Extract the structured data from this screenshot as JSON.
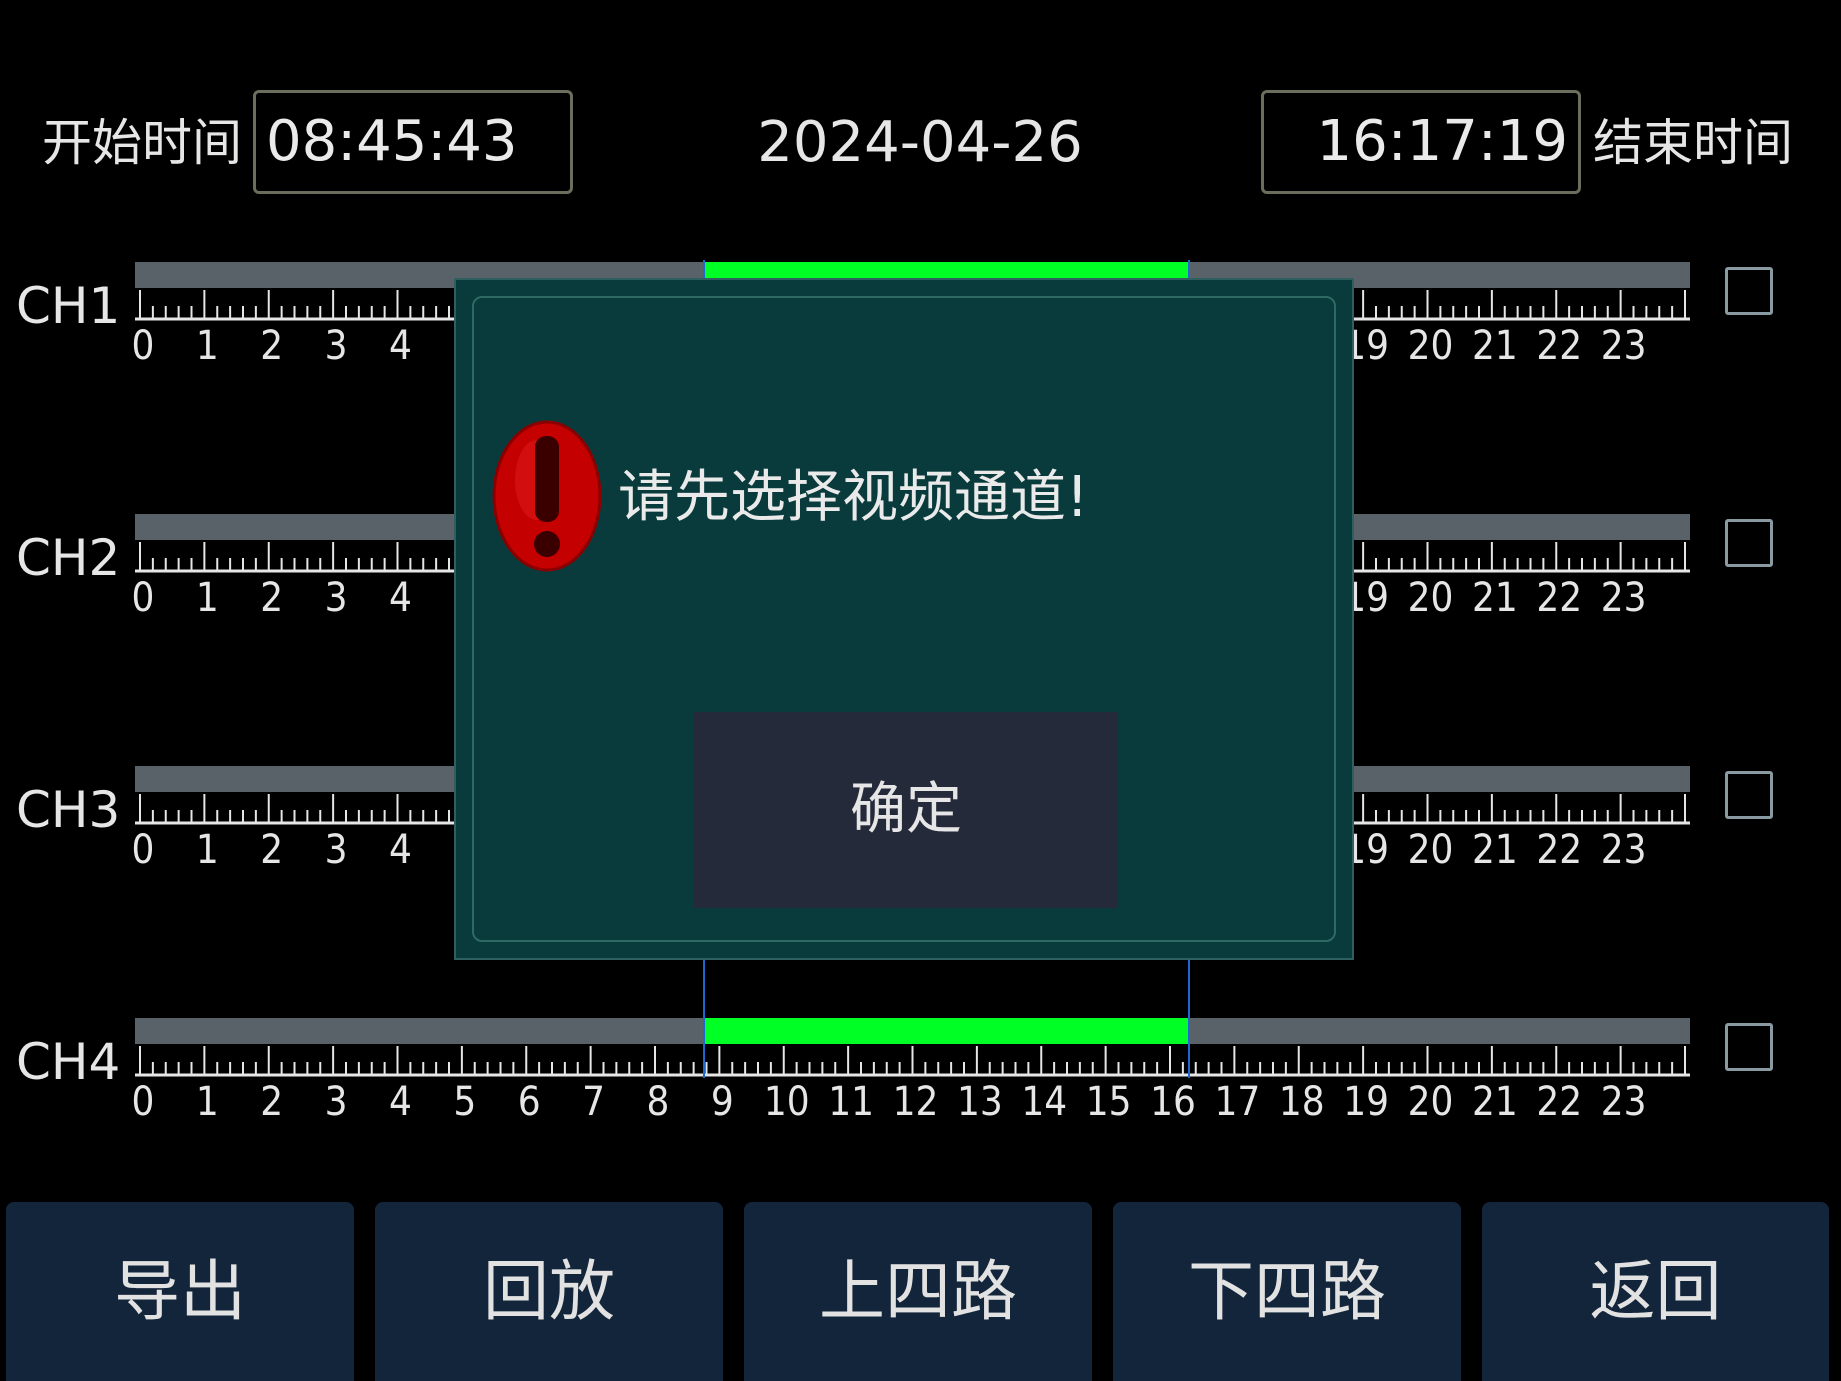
{
  "header": {
    "start_label": "开始时间",
    "start_time": "08:45:43",
    "date": "2024-04-26",
    "end_time": "16:17:19",
    "end_label": "结束时间"
  },
  "timeline": {
    "hour_labels": [
      "0",
      "1",
      "2",
      "3",
      "4",
      "5",
      "6",
      "7",
      "8",
      "9",
      "10",
      "11",
      "12",
      "13",
      "14",
      "15",
      "16",
      "17",
      "18",
      "19",
      "20",
      "21",
      "22",
      "23"
    ],
    "record_span": {
      "start_hour": 8.762,
      "end_hour": 16.288
    },
    "colors": {
      "track": "#596269",
      "record": "#00ff24",
      "cursor": "#1e66d0"
    }
  },
  "channels": [
    {
      "label": "CH1",
      "checked": false
    },
    {
      "label": "CH2",
      "checked": false
    },
    {
      "label": "CH3",
      "checked": false
    },
    {
      "label": "CH4",
      "checked": false
    }
  ],
  "buttons": {
    "export": "导出",
    "playback": "回放",
    "prev_four": "上四路",
    "next_four": "下四路",
    "back": "返回"
  },
  "dialog": {
    "icon": "warning-exclamation-icon",
    "message": "请先选择视频通道!",
    "ok": "确定"
  }
}
